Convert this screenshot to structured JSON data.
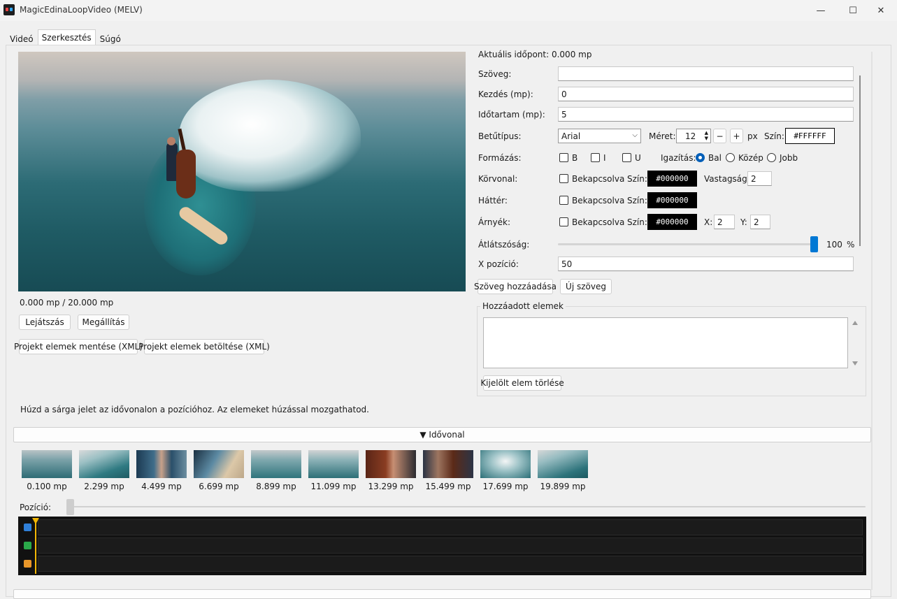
{
  "window": {
    "title": "MagicEdinaLoopVideo (MELV)",
    "min_symbol": "—",
    "max_symbol": "☐",
    "close_symbol": "✕"
  },
  "tabs": [
    {
      "label": "Videó"
    },
    {
      "label": "Szerkesztés"
    },
    {
      "label": "Súgó"
    }
  ],
  "active_tab": "Szerkesztés",
  "player": {
    "time_display": "0.000 mp / 20.000 mp",
    "play_label": "Lejátszás",
    "stop_label": "Megállítás",
    "save_xml_label": "Projekt elemek mentése (XML)",
    "load_xml_label": "Projekt elemek betöltése (XML)"
  },
  "editor": {
    "current_time": "Aktuális időpont: 0.000 mp",
    "text_label": "Szöveg:",
    "text_value": "",
    "start_label": "Kezdés (mp):",
    "start_value": "0",
    "duration_label": "Időtartam (mp):",
    "duration_value": "5",
    "font_label": "Betűtípus:",
    "font_value": "Arial",
    "size_label": "Méret:",
    "size_value": "12",
    "minus_label": "−",
    "plus_label": "+",
    "px_label": "px",
    "color_label": "Szín:",
    "color_value": "#FFFFFF",
    "format_label": "Formázás:",
    "bold_label": "B",
    "italic_label": "I",
    "underline_label": "U",
    "align_label": "Igazítás:",
    "align_options": [
      "Bal",
      "Közép",
      "Jobb"
    ],
    "align_selected": "Bal",
    "outline_label": "Körvonal:",
    "enabled_label": "Bekapcsolva",
    "outline_color": "#000000",
    "thickness_label": "Vastagság:",
    "thickness_value": "2",
    "background_label": "Háttér:",
    "background_color": "#000000",
    "shadow_label": "Árnyék:",
    "shadow_color": "#000000",
    "shadow_x_label": "X:",
    "shadow_x_value": "2",
    "shadow_y_label": "Y:",
    "shadow_y_value": "2",
    "opacity_label": "Átlátszóság:",
    "opacity_value": "100",
    "percent_label": "%",
    "xpos_label": "X pozíció:",
    "xpos_value": "50",
    "add_text_label": "Szöveg hozzáadása",
    "new_text_label": "Új szöveg",
    "added_group_title": "Hozzáadott elemek",
    "delete_selected_label": "Kijelölt elem törlése"
  },
  "hint": "Húzd a sárga jelet az idővonalon a pozícióhoz. Az elemeket húzással mozgathatod.",
  "timeline": {
    "header_label": "▼ Idővonal",
    "position_label": "Pozíció:",
    "position_value": 0,
    "thumbnails": [
      {
        "label": "0.100 mp"
      },
      {
        "label": "2.299 mp"
      },
      {
        "label": "4.499 mp"
      },
      {
        "label": "6.699 mp"
      },
      {
        "label": "8.899 mp"
      },
      {
        "label": "11.099 mp"
      },
      {
        "label": "13.299 mp"
      },
      {
        "label": "15.499 mp"
      },
      {
        "label": "17.699 mp"
      },
      {
        "label": "19.899 mp"
      }
    ],
    "track_icons": [
      "image-track-icon",
      "text-track-icon",
      "audio-track-icon"
    ]
  },
  "colors": {
    "accent": "#0078d4",
    "playhead": "#f2b705",
    "timeline_bg": "#111111"
  }
}
